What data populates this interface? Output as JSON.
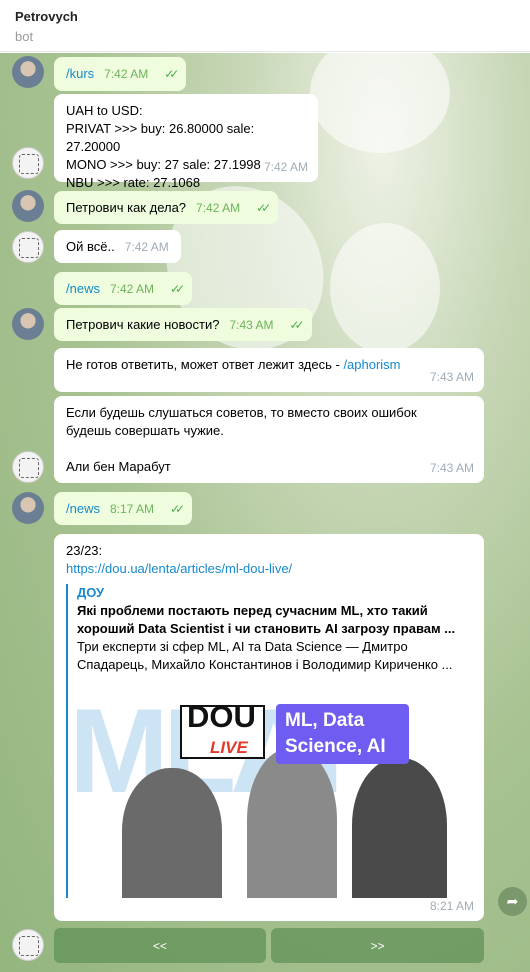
{
  "header": {
    "title": "Petrovych",
    "subtitle": "bot"
  },
  "messages": [
    {
      "text": "/kurs",
      "time": "7:42 AM"
    },
    {
      "lines": [
        "UAH to USD:",
        "PRIVAT >>>  buy: 26.80000 sale: 27.20000",
        "MONO >>>  buy: 27 sale: 27.1998",
        "NBU >>>  rate: 27.1068"
      ],
      "time": "7:42 AM"
    },
    {
      "text": "Петрович как дела?",
      "time": "7:42 AM"
    },
    {
      "text": "Ой всё..",
      "time": "7:42 AM"
    },
    {
      "text": "/news",
      "time": "7:42 AM"
    },
    {
      "text": "Петрович какие новости?",
      "time": "7:43 AM"
    },
    {
      "text": "Не готов ответить, может ответ лежит здесь - ",
      "link": "/aphorism",
      "time": "7:43 AM"
    },
    {
      "lines": [
        "Если будешь слушаться советов, то вместо своих ошибок",
        "будешь совершать чужие.",
        "",
        "Али бен Марабут"
      ],
      "time": "7:43 AM"
    },
    {
      "text": "/news",
      "time": "8:17 AM"
    },
    {
      "counter": "23/23:",
      "url": "https://dou.ua/lenta/articles/ml-dou-live/",
      "preview": {
        "site": "ДОУ",
        "title_lines": [
          "Які проблеми постають перед сучасним ML, хто такий",
          "хороший Data Scientist і чи становить AI загрозу правам ..."
        ],
        "desc_lines": [
          "Три експерти зі сфер ML, AI та Data Science — Дмитро",
          "Спадарець, Михайло Константинов і Володимир Кириченко ..."
        ],
        "image": {
          "dou": "DOU",
          "live": "LIVE",
          "ml": "ML, Data\nScience, AI"
        }
      },
      "time": "8:21 AM"
    }
  ],
  "keyboard": {
    "prev": "<<",
    "next": ">>"
  },
  "colors": {
    "accent": "#168acd",
    "out_bubble": "#effdde",
    "in_bubble": "#ffffff"
  }
}
